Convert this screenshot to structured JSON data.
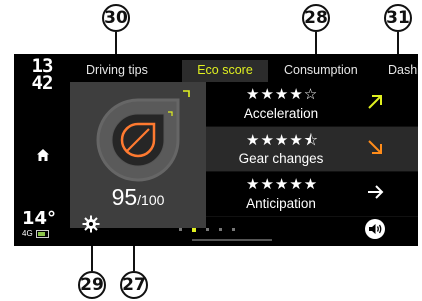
{
  "callouts": {
    "c30": "30",
    "c28": "28",
    "c31": "31",
    "c29": "29",
    "c27": "27"
  },
  "clock": {
    "hours": "13",
    "minutes": "42"
  },
  "weather": {
    "temp": "14°"
  },
  "network": {
    "label": "4G"
  },
  "tabs": [
    {
      "label": "Driving tips",
      "active": false
    },
    {
      "label": "Eco score",
      "active": true
    },
    {
      "label": "Consumption",
      "active": false
    },
    {
      "label": "Dashb",
      "active": false
    }
  ],
  "score": {
    "value": "95",
    "max": "/100"
  },
  "criteria": [
    {
      "label": "Acceleration",
      "stars": "★★★★☆",
      "rating": 4,
      "trend": "up",
      "trend_color": "#e0f020"
    },
    {
      "label": "Gear changes",
      "stars": "★★★★⯪",
      "rating": 4.5,
      "trend": "down",
      "trend_color": "#ff8c1a"
    },
    {
      "label": "Anticipation",
      "stars": "★★★★★",
      "rating": 5,
      "trend": "right",
      "trend_color": "#ffffff"
    }
  ],
  "pager": {
    "pages": 5,
    "current": 2
  },
  "colors": {
    "accent": "#e0f020",
    "warning": "#ff8c1a",
    "leaf": "#ff7a30",
    "panel": "#3e3e3e"
  },
  "icons": {
    "home": "home-icon",
    "settings": "gear-icon",
    "volume": "volume-icon",
    "eco": "leaf-icon"
  }
}
